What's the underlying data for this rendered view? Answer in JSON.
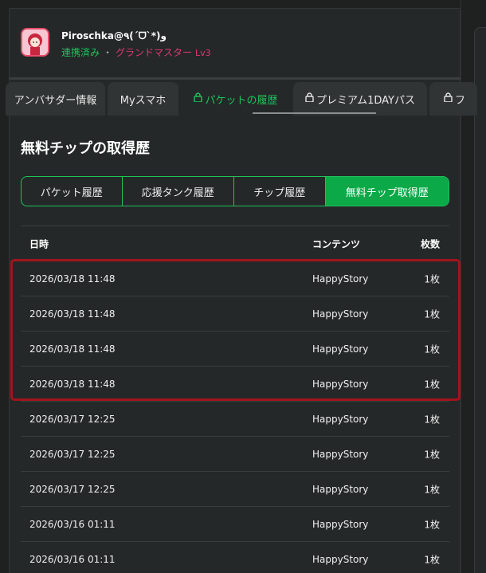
{
  "header": {
    "username": "Piroschka@٩(ˊᗜˋ*)و",
    "linked_status": "連携済み",
    "separator": "・",
    "rank": "グランドマスター",
    "level": "Lv3"
  },
  "tabs": [
    {
      "label": "アンバサダー情報",
      "locked": false,
      "active": false
    },
    {
      "label": "Myスマホ",
      "locked": false,
      "active": false
    },
    {
      "label": "パケットの履歴",
      "locked": true,
      "active": true
    },
    {
      "label": "プレミアム1DAYパス",
      "locked": true,
      "active": false
    },
    {
      "label": "フ",
      "locked": true,
      "active": false
    }
  ],
  "section_title": "無料チップの取得歴",
  "segments": [
    {
      "label": "パケット履歴",
      "active": false
    },
    {
      "label": "応援タンク履歴",
      "active": false
    },
    {
      "label": "チップ履歴",
      "active": false
    },
    {
      "label": "無料チップ取得歴",
      "active": true
    }
  ],
  "table": {
    "headers": {
      "date": "日時",
      "content": "コンテンツ",
      "count": "枚数"
    },
    "rows": [
      {
        "date": "2026/03/18 11:48",
        "content": "HappyStory",
        "count": "1枚"
      },
      {
        "date": "2026/03/18 11:48",
        "content": "HappyStory",
        "count": "1枚"
      },
      {
        "date": "2026/03/18 11:48",
        "content": "HappyStory",
        "count": "1枚"
      },
      {
        "date": "2026/03/18 11:48",
        "content": "HappyStory",
        "count": "1枚"
      },
      {
        "date": "2026/03/17 12:25",
        "content": "HappyStory",
        "count": "1枚"
      },
      {
        "date": "2026/03/17 12:25",
        "content": "HappyStory",
        "count": "1枚"
      },
      {
        "date": "2026/03/17 12:25",
        "content": "HappyStory",
        "count": "1枚"
      },
      {
        "date": "2026/03/16 01:11",
        "content": "HappyStory",
        "count": "1枚"
      },
      {
        "date": "2026/03/16 01:11",
        "content": "HappyStory",
        "count": "1枚"
      }
    ]
  },
  "colors": {
    "accent_green": "#1ec35c",
    "active_segment": "#0ba947",
    "rank_pink": "#e0376f",
    "highlight_red": "#a3141c"
  },
  "icons": {
    "lock": "lock-icon",
    "avatar": "avatar-image"
  }
}
